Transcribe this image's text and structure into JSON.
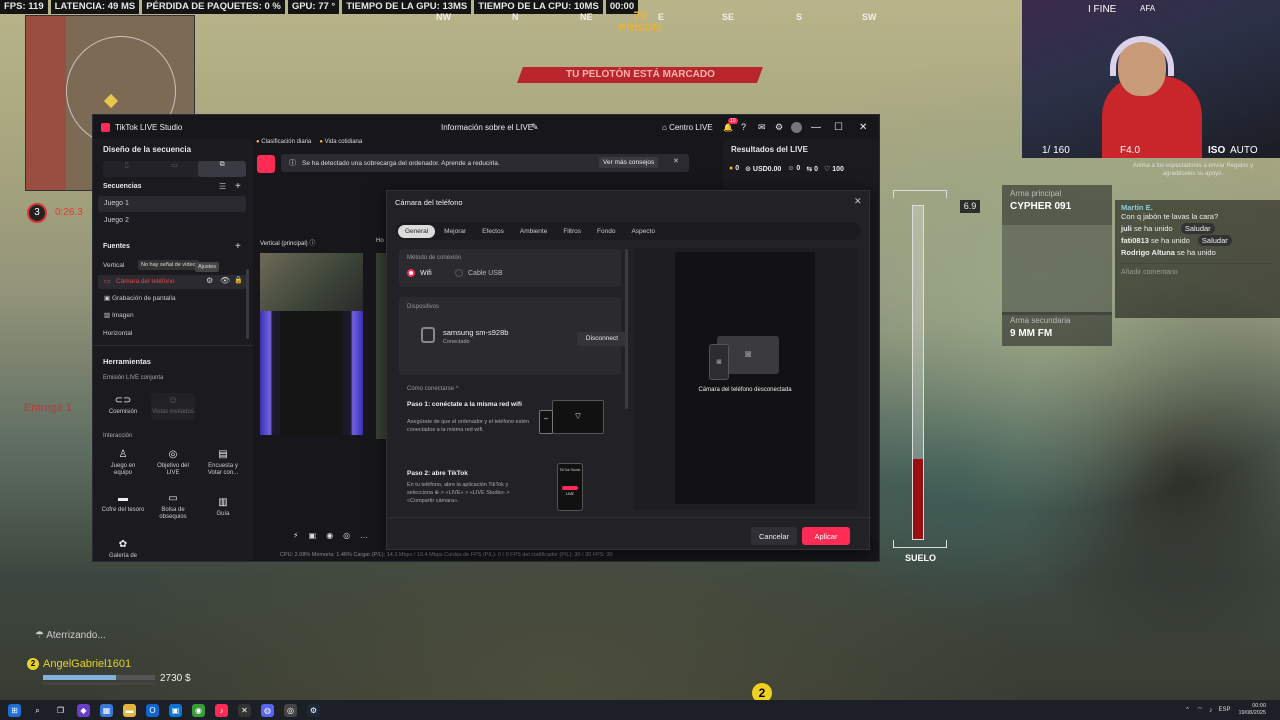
{
  "hud": {
    "fps": "FPS: 119",
    "latency": "LATENCIA: 49 MS",
    "packet_loss": "PÉRDIDA DE PAQUETES:  0 %",
    "gpu": "GPU: 77 °",
    "gpu_time": "TIEMPO DE LA GPU: 13MS",
    "cpu_time": "TIEMPO DE LA CPU: 10MS",
    "clock": "00:00",
    "compass": [
      "NW",
      "N",
      "NE",
      "E",
      "SE",
      "S",
      "SW"
    ],
    "heading": "79",
    "location": "PRISON",
    "banner": "TU PELOTÓN ESTÁ MARCADO",
    "squad_num": "3",
    "timer": "0:26.3",
    "altitude": "6.9",
    "altitude_level": 0.24,
    "ground_label": "SUELO",
    "landing_text": "Aterrizando...",
    "player_num": "2",
    "player_name": "AngelGabriel1601",
    "cash": "2730 $",
    "ping_num": "2",
    "side_label": "Entrega 1",
    "primary_label": "Arma principal",
    "primary_name": "CYPHER 091",
    "secondary_label": "Arma secundaria",
    "secondary_name": "9 MM FM",
    "cam_iso": "ISO",
    "cam_auto": "AUTO",
    "cam_frame": "1/ 160",
    "cam_fnum": "F4.0",
    "cam_top": "I FINE",
    "cam_tag": "AFA"
  },
  "chat": {
    "banner": "Anima a los espectadores a enviar Regalos y agradéceles su apoyo.",
    "messages": [
      {
        "user": "Martin E.",
        "text": "Con q jabón te lavas la cara?"
      },
      {
        "user": "juli",
        "text": "se ha unido",
        "action": "Saludar"
      },
      {
        "user": "fati0813",
        "text": "se ha unido",
        "action": "Saludar"
      },
      {
        "user": "Rodrigo Altuna",
        "text": "se ha unido"
      }
    ],
    "placeholder": "Añadir comentario"
  },
  "app": {
    "title": "TikTok LIVE Studio",
    "center_title": "Información sobre el LIVE",
    "live_center": "Centro LIVE",
    "notif_count": "10",
    "layout_title": "Diseño de la secuencia",
    "sequences_title": "Secuencias",
    "sequences": [
      "Juego 1",
      "Juego 2"
    ],
    "sources_title": "Fuentes",
    "vertical_label": "Vertical",
    "tooltip_no_signal": "No hay señal de vídeo",
    "tooltip_settings": "Ajustes",
    "sources": [
      "Cámara del teléfono",
      "Grabación de pantalla",
      "Imagen"
    ],
    "horizontal_label": "Horizontal",
    "tools_title": "Herramientas",
    "co_live_title": "Emisión LIVE conjunta",
    "co_host": "Coemisión",
    "invited_guests": "Vistas invitados",
    "interaction_title": "Interacción",
    "tools": [
      "Juego en equipo",
      "Objetivo del LIVE",
      "Encuesta y Votar con...",
      "Cofre del tesoro",
      "Bolsa de obsequios",
      "Guía",
      "Galería de"
    ],
    "pill_trending": "Clasificación diaria",
    "pill_daily": "Vida cotidiana",
    "overload_msg": "Se ha detectado una sobrecarga del ordenador. Aprende a reducirla.",
    "more_tips": "Ver más consejos",
    "preview_vertical": "Vertical (principal)",
    "preview_horizontal": "Ho",
    "results_title": "Resultados del LIVE",
    "stat_coins": "0",
    "stat_usd": "USD0.00",
    "stat_viewers": "0",
    "stat_shares": "0",
    "stat_likes": "100",
    "stats_footer": "CPU: 2.08%    Memoria: 1.46%    Cargar (P/L): 14.3 Mbps / 10.4 Mbps    Caídas de FPS (P/L): 0 / 0    FPS del codificador (P/L): 30 / 30    FPS: 30"
  },
  "dialog": {
    "title": "Cámara del teléfono",
    "tabs": [
      "General",
      "Mejorar",
      "Efectos",
      "Ambiente",
      "Filtros",
      "Fondo",
      "Aspecto"
    ],
    "connection_label": "Método de conexión",
    "wifi": "Wifi",
    "usb": "Cable USB",
    "devices_label": "Dispositivos",
    "device_name": "samsung sm-s928b",
    "device_status": "Conectado",
    "disconnect": "Disconnect",
    "how_label": "Cómo conectarse ^",
    "step1_title": "Paso 1: conéctate a la misma red wifi",
    "step1_desc": "Asegúrate de que el ordenador y el teléfono estén conectados a la misma red wifi.",
    "step2_title": "Paso 2: abre TikTok",
    "step2_desc": "En tu teléfono, abre la aplicación TikTok y selecciona ⊕ > «LIVE» > «LIVE Studio» > «Compartir cámara».",
    "phone_app": "TikTok Studio",
    "phone_live": "LIVE",
    "preview_status": "Cámara del teléfono desconectada",
    "cancel": "Cancelar",
    "apply": "Aplicar"
  },
  "taskbar": {
    "lang": "ESP",
    "time": "00:00",
    "date": "19/08/2025"
  }
}
